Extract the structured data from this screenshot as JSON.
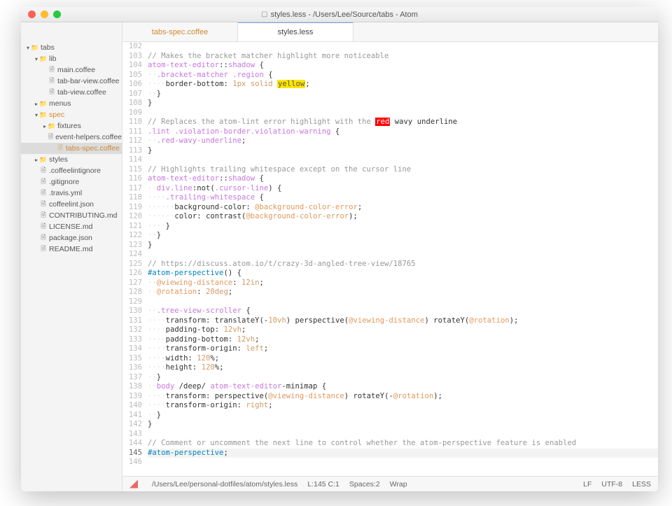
{
  "window": {
    "title": "styles.less - /Users/Lee/Source/tabs - Atom"
  },
  "sidebar": {
    "root": "tabs",
    "items": [
      {
        "depth": 0,
        "type": "folder",
        "open": true,
        "label": "tabs",
        "active": false
      },
      {
        "depth": 1,
        "type": "folder",
        "open": true,
        "label": "lib",
        "active": false
      },
      {
        "depth": 2,
        "type": "file",
        "label": "main.coffee"
      },
      {
        "depth": 2,
        "type": "file",
        "label": "tab-bar-view.coffee"
      },
      {
        "depth": 2,
        "type": "file",
        "label": "tab-view.coffee"
      },
      {
        "depth": 1,
        "type": "folder",
        "open": false,
        "label": "menus"
      },
      {
        "depth": 1,
        "type": "folder",
        "open": true,
        "label": "spec",
        "active": true
      },
      {
        "depth": 2,
        "type": "folder",
        "open": false,
        "label": "fixtures"
      },
      {
        "depth": 3,
        "type": "file",
        "label": "event-helpers.coffee"
      },
      {
        "depth": 3,
        "type": "file",
        "label": "tabs-spec.coffee",
        "active": true,
        "selected": true
      },
      {
        "depth": 1,
        "type": "folder",
        "open": false,
        "label": "styles"
      },
      {
        "depth": 1,
        "type": "file",
        "label": ".coffeelintignore"
      },
      {
        "depth": 1,
        "type": "file",
        "label": ".gitignore"
      },
      {
        "depth": 1,
        "type": "file",
        "label": ".travis.yml"
      },
      {
        "depth": 1,
        "type": "file",
        "label": "coffeelint.json"
      },
      {
        "depth": 1,
        "type": "file",
        "label": "CONTRIBUTING.md"
      },
      {
        "depth": 1,
        "type": "file",
        "label": "LICENSE.md"
      },
      {
        "depth": 1,
        "type": "file",
        "label": "package.json"
      },
      {
        "depth": 1,
        "type": "file",
        "label": "README.md"
      }
    ]
  },
  "tabs": [
    {
      "label": "tabs-spec.coffee",
      "active": false,
      "modified": true
    },
    {
      "label": "styles.less",
      "active": true,
      "modified": false
    }
  ],
  "editor": {
    "first_line": 102,
    "cursor_line": 145,
    "lines": [
      "",
      "// Makes the bracket matcher highlight more noticeable",
      "atom-text-editor::shadow {",
      "··.bracket-matcher .region {",
      "····border-bottom: 1px solid §Yyellow§;",
      "··}",
      "}",
      "",
      "// Replaces the atom-lint error highlight with the §Rred§ wavy underline",
      ".lint .violation-border.violation-warning {",
      "··.red-wavy-underline;",
      "}",
      "",
      "// Highlights trailing whitespace except on the cursor line",
      "atom-text-editor::shadow {",
      "··div.line:not(.cursor-line) {",
      "····.trailing-whitespace {",
      "······background-color: @background-color-error;",
      "······color: contrast(@background-color-error);",
      "····}",
      "··}",
      "}",
      "",
      "// https://discuss.atom.io/t/crazy-3d-angled-tree-view/18765",
      "#atom-perspective() {",
      "··@viewing-distance: 12in;",
      "··@rotation: 20deg;",
      "",
      "··.tree-view-scroller {",
      "····transform: translateY(-10vh) perspective(@viewing-distance) rotateY(@rotation);",
      "····padding-top: 12vh;",
      "····padding-bottom: 12vh;",
      "····transform-origin: left;",
      "····width: 120%;",
      "····height: 120%;",
      "··}",
      "··body /deep/ atom-text-editor-minimap {",
      "····transform: perspective(@viewing-distance) rotateY(-@rotation);",
      "····transform-origin: right;",
      "··}",
      "}",
      "",
      "// Comment or uncomment the next line to control whether the atom-perspective feature is enabled",
      "#atom-perspective;",
      ""
    ]
  },
  "statusbar": {
    "path": "/Users/Lee/personal-dotfiles/atom/styles.less",
    "cursor": "L:145 C:1",
    "spaces": "Spaces:2",
    "wrap": "Wrap",
    "lf": "LF",
    "encoding": "UTF-8",
    "grammar": "LESS"
  }
}
